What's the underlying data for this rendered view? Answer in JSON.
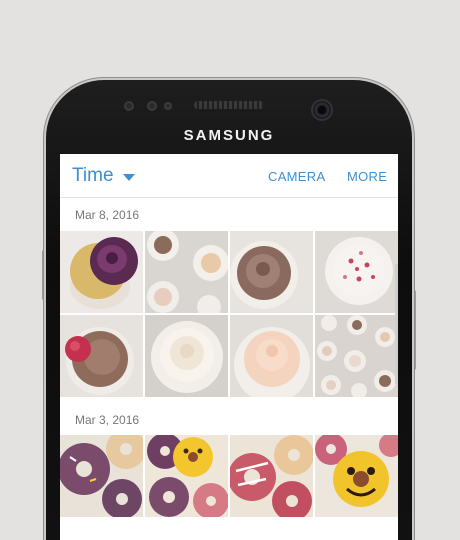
{
  "device": {
    "brand": "SAMSUNG"
  },
  "app_bar": {
    "title": "Time",
    "actions": [
      "CAMERA",
      "MORE"
    ],
    "accent_color": "#3d8fd0"
  },
  "sections": [
    {
      "date": "Mar 8, 2016",
      "photos": [
        "purple-frosted-cupcake",
        "mini-cupcakes",
        "chocolate-swirl-cupcake",
        "cupcake-with-sprinkles",
        "cupcake-with-raspberry",
        "white-frosted-cupcake",
        "peach-frosted-cupcake",
        "mini-cupcakes-tray"
      ]
    },
    {
      "date": "Mar 3, 2016",
      "photos": [
        "frosted-donuts",
        "smiley-donuts",
        "glazed-donuts",
        "smiley-donut-closeup"
      ]
    }
  ]
}
